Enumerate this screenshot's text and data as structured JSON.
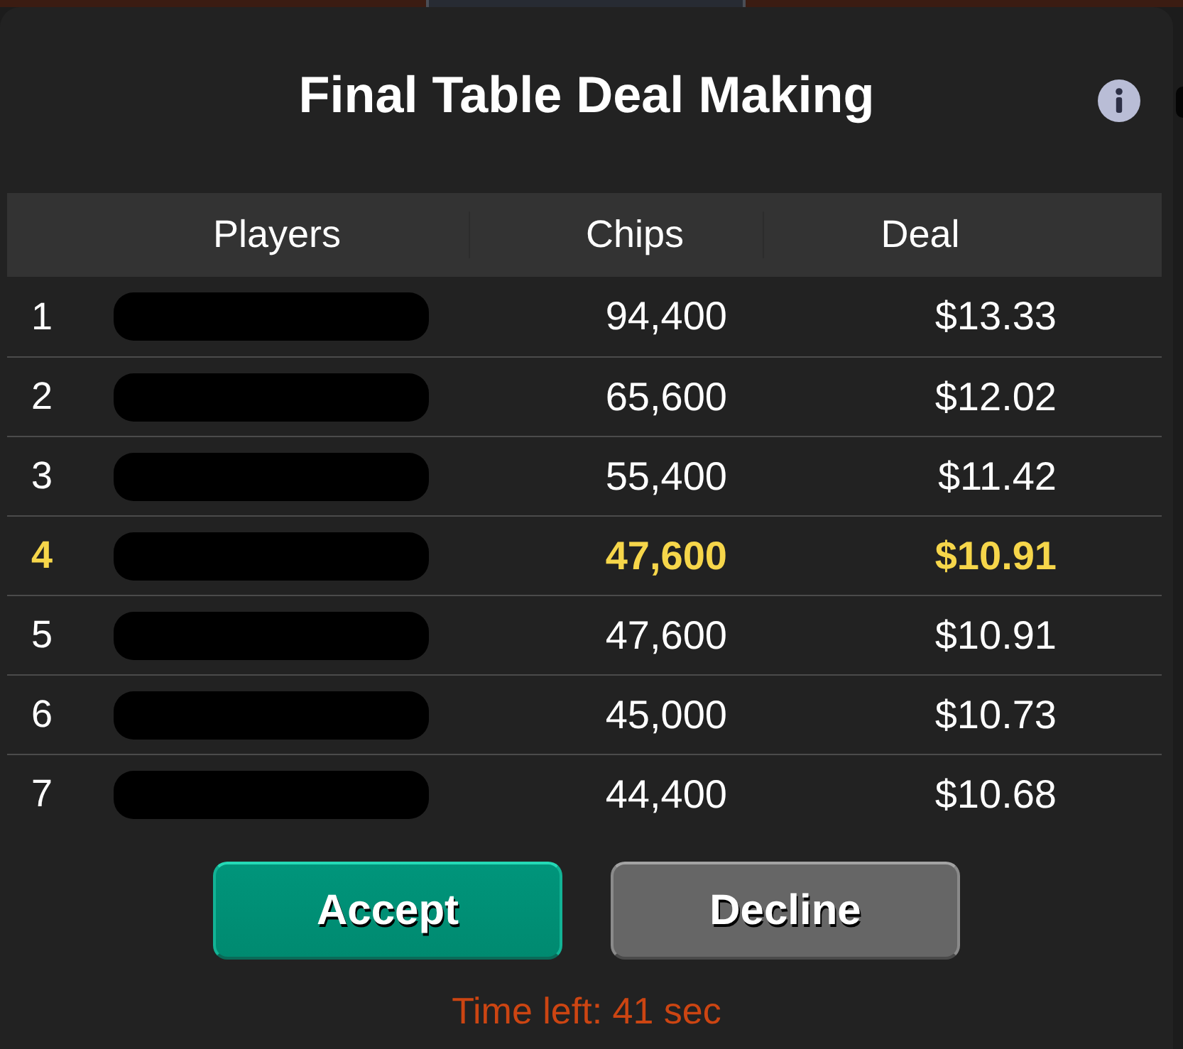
{
  "window": {
    "title": "Final Table Deal Making"
  },
  "table": {
    "columns": [
      "Players",
      "Chips",
      "Deal"
    ],
    "rows": [
      {
        "rank": "1",
        "chips": "94,400",
        "deal": "$13.33",
        "selected": false
      },
      {
        "rank": "2",
        "chips": "65,600",
        "deal": "$12.02",
        "selected": false
      },
      {
        "rank": "3",
        "chips": "55,400",
        "deal": "$11.42",
        "selected": false
      },
      {
        "rank": "4",
        "chips": "47,600",
        "deal": "$10.91",
        "selected": true
      },
      {
        "rank": "5",
        "chips": "47,600",
        "deal": "$10.91",
        "selected": false
      },
      {
        "rank": "6",
        "chips": "45,000",
        "deal": "$10.73",
        "selected": false
      },
      {
        "rank": "7",
        "chips": "44,400",
        "deal": "$10.68",
        "selected": false
      }
    ]
  },
  "buttons": [
    {
      "label": "Accept",
      "kind": "accept"
    },
    {
      "label": "Decline",
      "kind": "decline"
    }
  ],
  "status": {
    "time_left": "Time left: 41 sec"
  }
}
